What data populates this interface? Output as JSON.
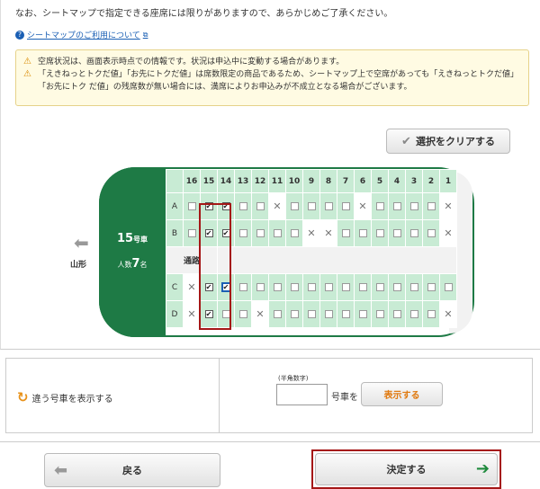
{
  "intro": {
    "text": "なお、シートマップで指定できる座席には限りがありますので、あらかじめご了承ください。",
    "link_label": "シートマップのご利用について"
  },
  "warnings": [
    "空席状況は、画面表示時点での情報です。状況は申込中に変動する場合があります。",
    "「えきねっとトクだ値」「お先にトクだ値」は席数限定の商品であるため、シートマップ上で空席があっても「えきねっとトクだ値」「お先にトク だ値」の残席数が無い場合には、満席によりお申込みが不成立となる場合がございます。"
  ],
  "toolbar": {
    "clear_label": "選択をクリアする"
  },
  "car": {
    "number": "15",
    "number_suffix": "号車",
    "people_prefix": "人数",
    "people_count": "7",
    "people_suffix": "名",
    "origin": "山形",
    "aisle_label": "通路"
  },
  "seat_columns": [
    "16",
    "15",
    "14",
    "13",
    "12",
    "11",
    "10",
    "9",
    "8",
    "7",
    "6",
    "5",
    "4",
    "3",
    "2",
    "1"
  ],
  "seat_rows": [
    {
      "label": "A",
      "seats": [
        "empty",
        "checked",
        "checked",
        "empty",
        "empty",
        "taken",
        "empty",
        "empty",
        "empty",
        "empty",
        "taken",
        "empty",
        "empty",
        "empty",
        "empty",
        "taken"
      ]
    },
    {
      "label": "B",
      "seats": [
        "empty",
        "checked",
        "checked",
        "empty",
        "empty",
        "empty",
        "empty",
        "taken",
        "taken",
        "empty",
        "empty",
        "empty",
        "empty",
        "empty",
        "empty",
        "taken"
      ]
    },
    {
      "label": "C",
      "seats": [
        "taken",
        "checked",
        "focused",
        "empty",
        "empty",
        "empty",
        "empty",
        "empty",
        "empty",
        "empty",
        "empty",
        "empty",
        "empty",
        "empty",
        "empty",
        "empty"
      ]
    },
    {
      "label": "D",
      "seats": [
        "taken",
        "checked",
        "empty",
        "empty",
        "taken",
        "empty",
        "empty",
        "empty",
        "empty",
        "empty",
        "empty",
        "empty",
        "empty",
        "empty",
        "empty",
        "taken"
      ]
    }
  ],
  "alt_car": {
    "label": "違う号車を表示する",
    "input_note": "(半角数字)",
    "input_value": "",
    "suffix": "号車を",
    "show_label": "表示する"
  },
  "footer": {
    "back_label": "戻る",
    "decide_label": "決定する"
  },
  "colors": {
    "car_green": "#1e7a45",
    "seat_green": "#c8ebd4",
    "highlight_red": "#a51717",
    "warning_bg": "#fffbe3",
    "link_blue": "#1a5fb4"
  }
}
